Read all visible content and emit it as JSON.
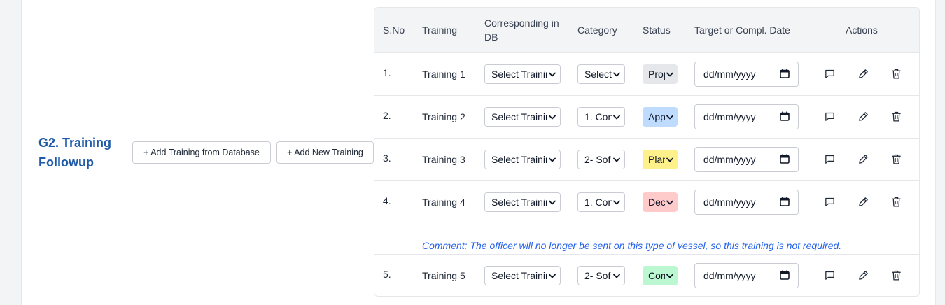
{
  "section": {
    "title": "G2. Training Followup",
    "add_from_db_label": "+ Add Training from Database",
    "add_new_label": "+ Add New Training"
  },
  "table": {
    "headers": {
      "sno": "S.No",
      "training": "Training",
      "corresponding": "Corresponding in DB",
      "category": "Category",
      "status": "Status",
      "date": "Target or Compl. Date",
      "actions": "Actions"
    },
    "rows": [
      {
        "sno": "1.",
        "training": "Training 1",
        "db": "Select Training",
        "category": "Select",
        "status": "Proposed",
        "status_color": "#e5e7eb",
        "date": "dd/mm/yyyy"
      },
      {
        "sno": "2.",
        "training": "Training 2",
        "db": "Select Training",
        "category": "1. Con",
        "status": "Approved",
        "status_color": "#bfdbfe",
        "date": "dd/mm/yyyy"
      },
      {
        "sno": "3.",
        "training": "Training 3",
        "db": "Select Training",
        "category": "2- Sof",
        "status": "Planned",
        "status_color": "#fef08a",
        "date": "dd/mm/yyyy"
      },
      {
        "sno": "4.",
        "training": "Training 4",
        "db": "Select Training",
        "category": "1. Con",
        "status": "Declined",
        "status_color": "#fecaca",
        "date": "dd/mm/yyyy",
        "comment": "Comment: The officer will no longer be sent on this type of vessel, so this training is not required."
      },
      {
        "sno": "5.",
        "training": "Training 5",
        "db": "Select Training",
        "category": "2- Sof",
        "status": "Completed",
        "status_color": "#bbf7d0",
        "date": "dd/mm/yyyy"
      }
    ]
  },
  "icons": {
    "comment": "comment-icon",
    "edit": "pencil-icon",
    "delete": "trash-icon",
    "calendar": "calendar-icon",
    "chevron": "chevron-down-icon"
  },
  "colors": {
    "section_title": "#1e5aa8",
    "comment_text": "#2563eb"
  }
}
